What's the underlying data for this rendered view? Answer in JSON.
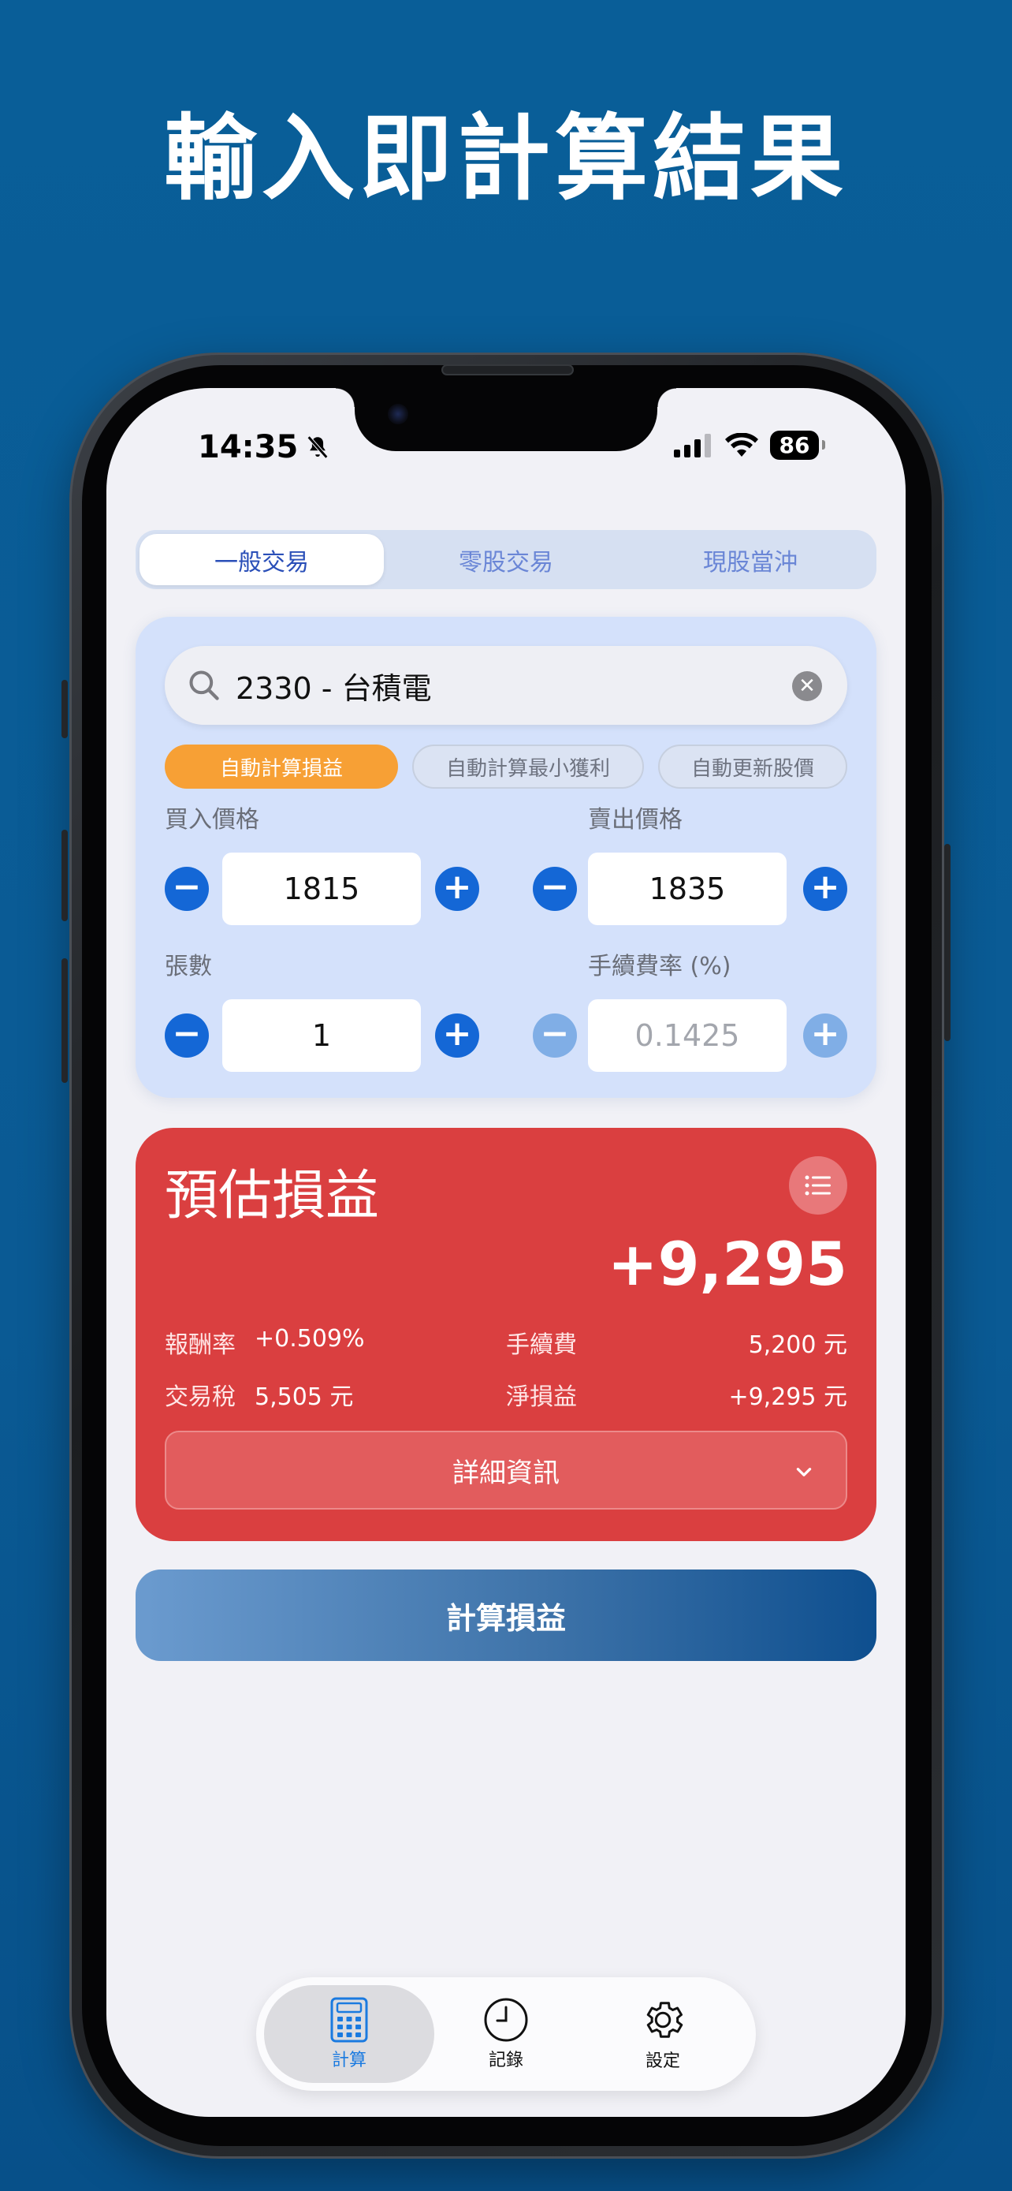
{
  "headline": "輸入即計算結果",
  "status_bar": {
    "time": "14:35",
    "battery": "86"
  },
  "segments": [
    "一般交易",
    "零股交易",
    "現股當沖"
  ],
  "search": {
    "value": "2330 - 台積電"
  },
  "chips": [
    "自動計算損益",
    "自動計算最小獲利",
    "自動更新股價"
  ],
  "fields": {
    "buy_price": {
      "label": "買入價格",
      "value": "1815"
    },
    "sell_price": {
      "label": "賣出價格",
      "value": "1835"
    },
    "shares": {
      "label": "張數",
      "value": "1"
    },
    "fee_rate": {
      "label": "手續費率 (%)",
      "value": "0.1425"
    }
  },
  "result": {
    "title": "預估損益",
    "amount": "+9,295",
    "return_rate_label": "報酬率",
    "return_rate_value": "+0.509%",
    "fee_label": "手續費",
    "fee_value": "5,200 元",
    "tax_label": "交易稅",
    "tax_value": "5,505 元",
    "net_label": "淨損益",
    "net_value": "+9,295 元",
    "details_label": "詳細資訊"
  },
  "calc_button": "計算損益",
  "tabs": [
    {
      "label": "計算",
      "icon": "calculator-icon"
    },
    {
      "label": "記錄",
      "icon": "clock-icon"
    },
    {
      "label": "設定",
      "icon": "gear-icon"
    }
  ],
  "colors": {
    "background": "#095e98",
    "accent_blue": "#1467d6",
    "chip_orange": "#f7a035",
    "result_red": "#da3f40"
  }
}
